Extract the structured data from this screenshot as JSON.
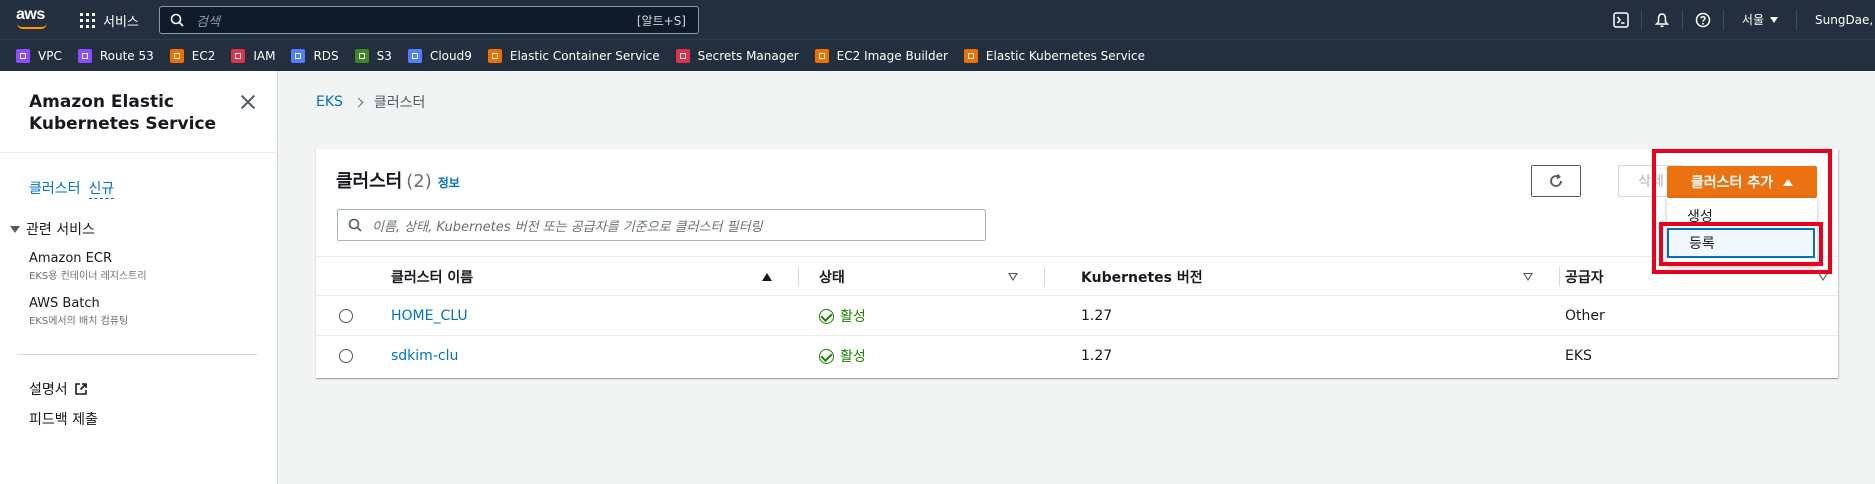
{
  "topnav": {
    "logo": "aws",
    "services_label": "서비스",
    "search_placeholder": "검색",
    "search_shortcut": "[알트+S]",
    "region": "서울",
    "user": "SungDae, Ki"
  },
  "favorites": [
    {
      "label": "VPC",
      "color": "#8c4fff"
    },
    {
      "label": "Route 53",
      "color": "#8c4fff"
    },
    {
      "label": "EC2",
      "color": "#ed7100"
    },
    {
      "label": "IAM",
      "color": "#dd344c"
    },
    {
      "label": "RDS",
      "color": "#527fff"
    },
    {
      "label": "S3",
      "color": "#3f8624"
    },
    {
      "label": "Cloud9",
      "color": "#527fff"
    },
    {
      "label": "Elastic Container Service",
      "color": "#ed7100"
    },
    {
      "label": "Secrets Manager",
      "color": "#dd344c"
    },
    {
      "label": "EC2 Image Builder",
      "color": "#ed7100"
    },
    {
      "label": "Elastic Kubernetes Service",
      "color": "#ed7100"
    }
  ],
  "sidebar": {
    "title": "Amazon Elastic Kubernetes Service",
    "clusters": "클러스터",
    "new_badge": "신규",
    "related": "관련 서비스",
    "ecr": "Amazon ECR",
    "ecr_desc": "EKS용 컨테이너 레지스트리",
    "batch": "AWS Batch",
    "batch_desc": "EKS에서의 배치 컴퓨팅",
    "docs": "설명서",
    "feedback": "피드백 제출"
  },
  "breadcrumb": {
    "root": "EKS",
    "current": "클러스터"
  },
  "panel": {
    "title": "클러스터",
    "count": "(2)",
    "info": "정보",
    "delete": "삭제",
    "add": "클러스터 추가",
    "filter_placeholder": "이름, 상태, Kubernetes 버전 또는 공급자를 기준으로 클러스터 필터링",
    "menu_create": "생성",
    "menu_register": "등록"
  },
  "table": {
    "headers": [
      "클러스터 이름",
      "상태",
      "Kubernetes 버전",
      "공급자"
    ],
    "rows": [
      {
        "name": "HOME_CLU",
        "status": "활성",
        "version": "1.27",
        "provider": "Other"
      },
      {
        "name": "sdkim-clu",
        "status": "활성",
        "version": "1.27",
        "provider": "EKS"
      }
    ]
  },
  "colors": {
    "primary": "#ec7211",
    "link": "#0073bb",
    "success": "#1d8102",
    "highlight": "#e8001c",
    "nav": "#232f3e"
  }
}
